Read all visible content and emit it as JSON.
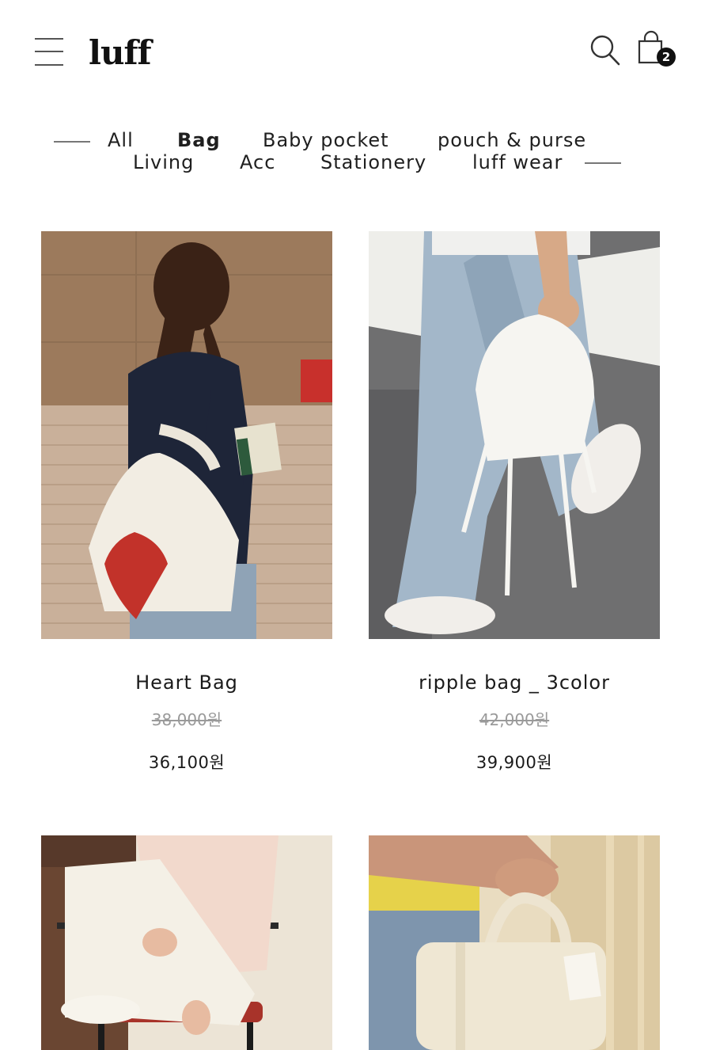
{
  "header": {
    "logo": "luff",
    "cart_count": "2",
    "icons": {
      "menu": "hamburger-icon",
      "search": "search-icon",
      "cart": "shopping-bag-icon"
    }
  },
  "categories": [
    {
      "label": "All",
      "active": false
    },
    {
      "label": "Bag",
      "active": true
    },
    {
      "label": "Baby pocket",
      "active": false
    },
    {
      "label": "pouch & purse",
      "active": false
    },
    {
      "label": "Living",
      "active": false
    },
    {
      "label": "Acc",
      "active": false
    },
    {
      "label": "Stationery",
      "active": false
    },
    {
      "label": "luff wear",
      "active": false
    }
  ],
  "products": [
    {
      "name": "Heart Bag",
      "original_price": "38,000원",
      "price": "36,100원"
    },
    {
      "name": "ripple bag _ 3color",
      "original_price": "42,000원",
      "price": "39,900원"
    },
    {
      "name": "",
      "original_price": "",
      "price": ""
    },
    {
      "name": "",
      "original_price": "",
      "price": ""
    }
  ],
  "colors": {
    "text": "#1a1a1a",
    "strike": "#9a9a9a",
    "badge": "#111111"
  }
}
